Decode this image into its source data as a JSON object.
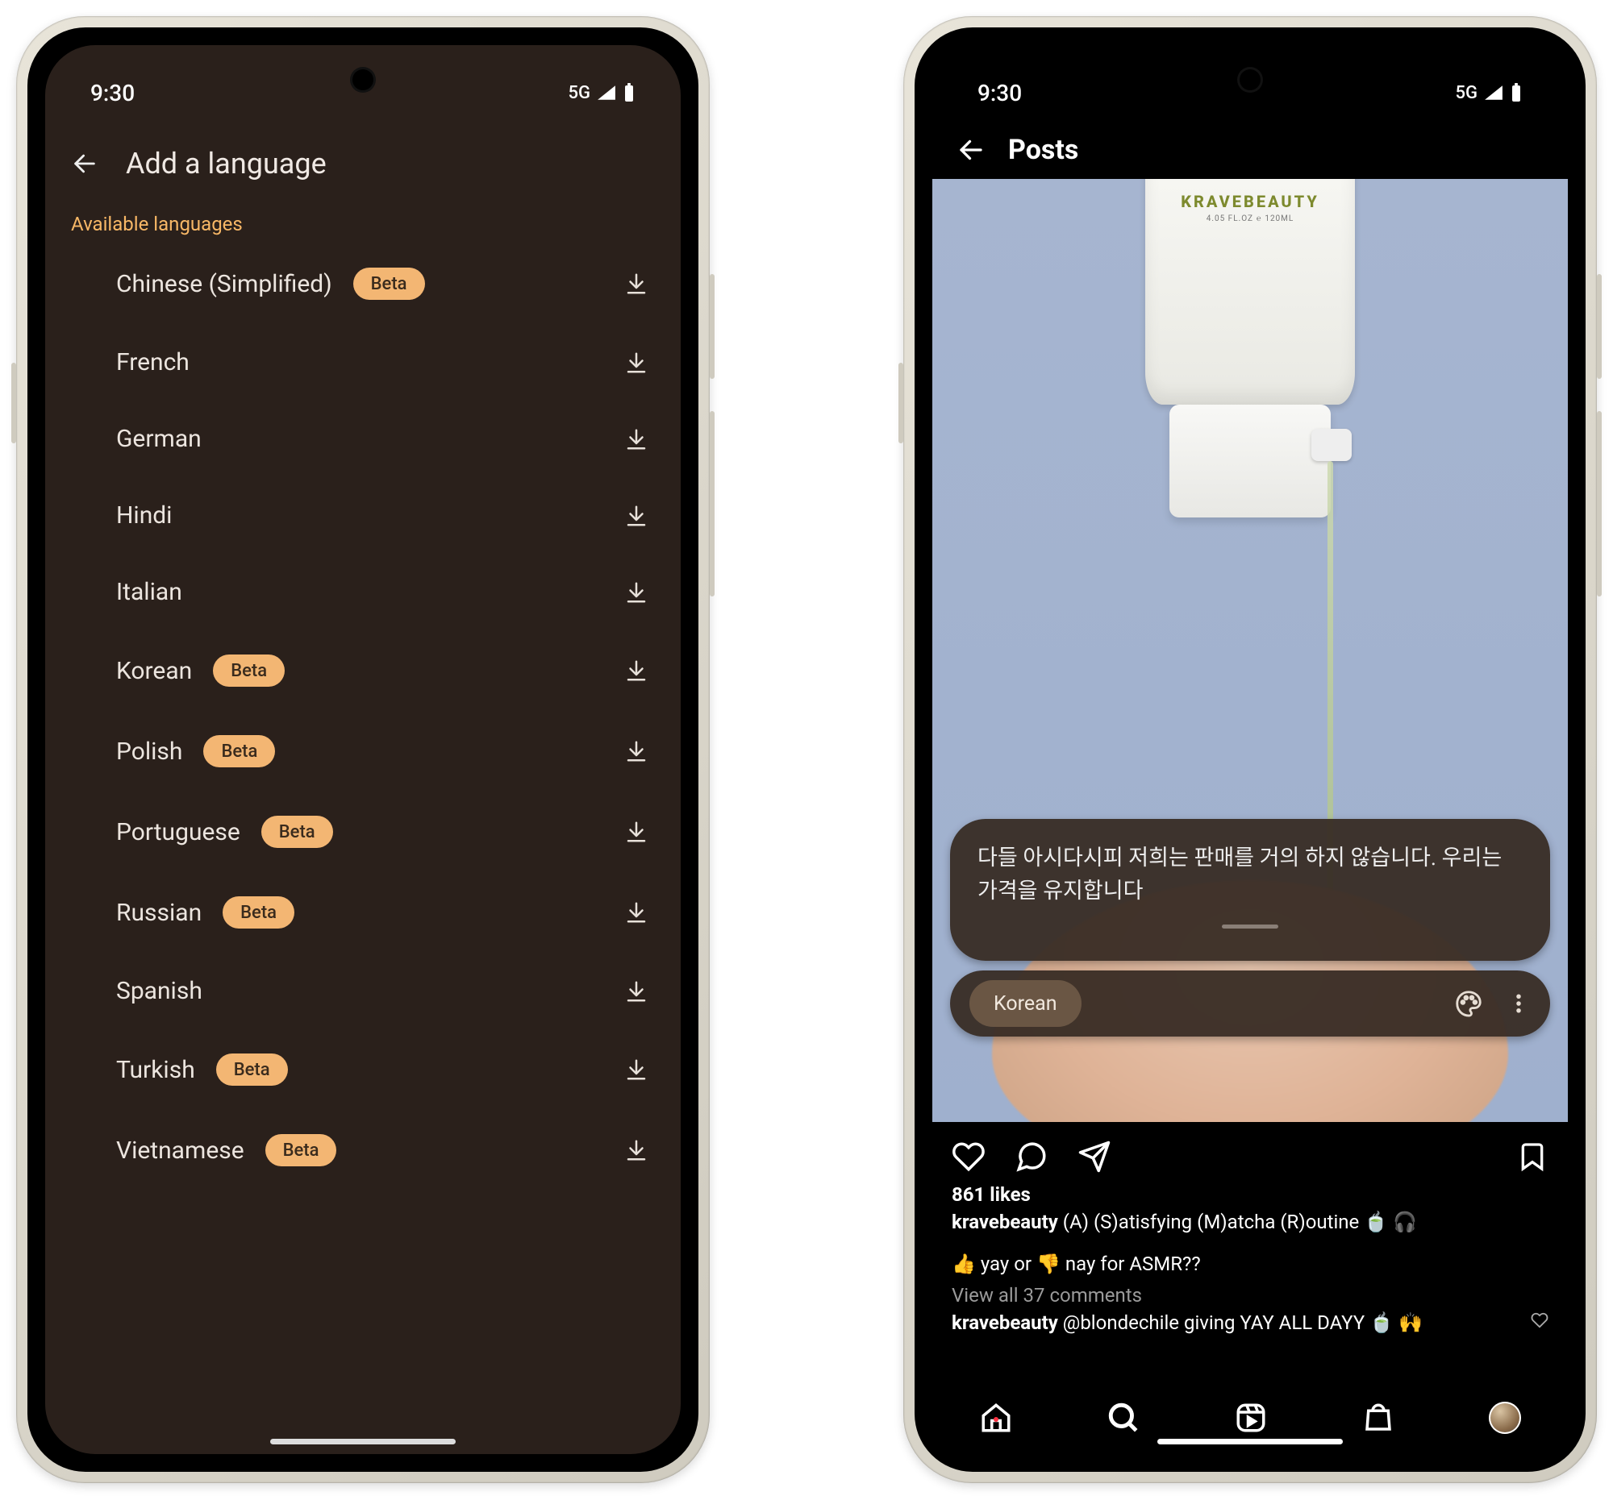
{
  "status": {
    "time": "9:30",
    "network": "5G"
  },
  "left": {
    "title": "Add a language",
    "section": "Available languages",
    "beta_label": "Beta",
    "items": [
      {
        "name": "Chinese (Simplified)",
        "beta": true
      },
      {
        "name": "French",
        "beta": false
      },
      {
        "name": "German",
        "beta": false
      },
      {
        "name": "Hindi",
        "beta": false
      },
      {
        "name": "Italian",
        "beta": false
      },
      {
        "name": "Korean",
        "beta": true
      },
      {
        "name": "Polish",
        "beta": true
      },
      {
        "name": "Portuguese",
        "beta": true
      },
      {
        "name": "Russian",
        "beta": true
      },
      {
        "name": "Spanish",
        "beta": false
      },
      {
        "name": "Turkish",
        "beta": true
      },
      {
        "name": "Vietnamese",
        "beta": true
      }
    ]
  },
  "right": {
    "title": "Posts",
    "product_brand": "KRAVEBEAUTY",
    "product_sub": "4.05 FL.OZ ℮ 120ML",
    "caption_overlay": "다들 아시다시피 저희는 판매를 거의 하지 않습니다. 우리는 가격을 유지합니다",
    "lang_chip": "Korean",
    "likes": "861 likes",
    "user": "kravebeauty",
    "caption": "(A) (S)atisfying (M)atcha (R)outine 🍵 🎧",
    "caption2": "👍 yay or 👎 nay for ASMR??",
    "view_all": "View all 37 comments",
    "comment_user": "kravebeauty",
    "comment_text": "@blondechile giving YAY ALL DAYY 🍵 🙌"
  }
}
